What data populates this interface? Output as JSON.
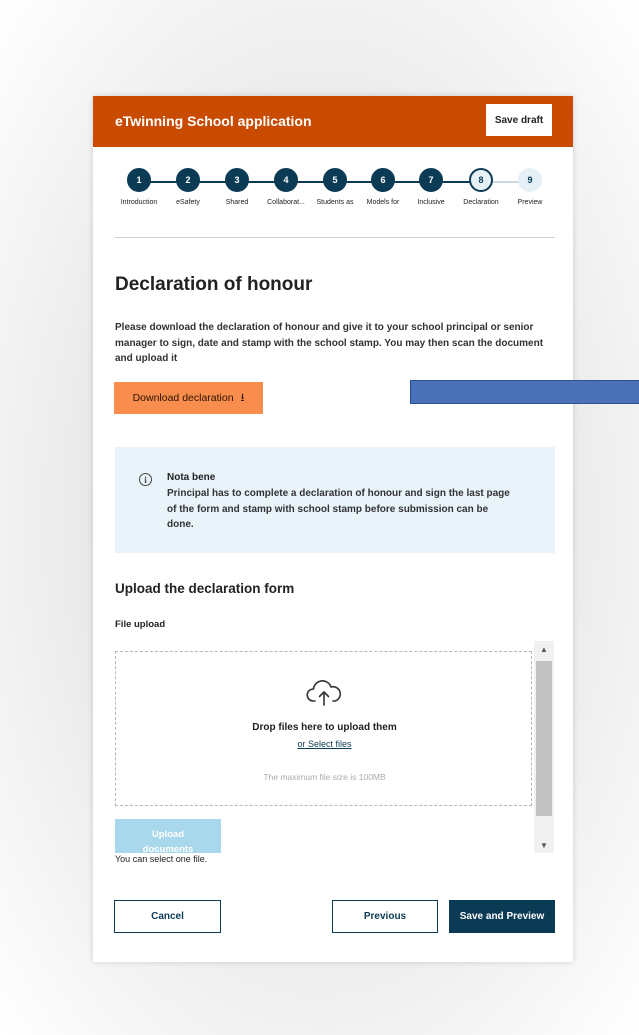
{
  "header": {
    "title": "eTwinning School application",
    "save_draft": "Save draft",
    "color": "#c84b00"
  },
  "stepper": {
    "steps": [
      {
        "number": "1",
        "label": "Introduction",
        "state": "done"
      },
      {
        "number": "2",
        "label": "eSafety",
        "state": "done"
      },
      {
        "number": "3",
        "label": "Shared",
        "state": "done"
      },
      {
        "number": "4",
        "label": "Collaborat...",
        "state": "done"
      },
      {
        "number": "5",
        "label": "Students as",
        "state": "done"
      },
      {
        "number": "6",
        "label": "Models for",
        "state": "done"
      },
      {
        "number": "7",
        "label": "Inclusive",
        "state": "done"
      },
      {
        "number": "8",
        "label": "Declaration",
        "state": "current"
      },
      {
        "number": "9",
        "label": "Preview",
        "state": "future"
      }
    ]
  },
  "main": {
    "title": "Declaration of honour",
    "intro": "Please download the declaration of honour and give it to your school principal or senior manager to sign, date and stamp with the school stamp. You may then scan the document and upload it",
    "download_label": "Download declaration",
    "note": {
      "title": "Nota bene",
      "text": "Principal has to complete a declaration of honour and sign the last page of the form and stamp with school stamp before submission can be done."
    },
    "upload_heading": "Upload the declaration form",
    "file_label": "File upload",
    "dropzone": {
      "drop_text": "Drop files here to upload them",
      "select_link": "or Select files",
      "max_size": "The maximum file size is 100MB"
    },
    "upload_button": "Upload documents",
    "select_hint": "You can select one file."
  },
  "footer": {
    "cancel": "Cancel",
    "previous": "Previous",
    "save_preview": "Save and Preview"
  },
  "colors": {
    "primary": "#0b3a55",
    "accent": "#f98d4e",
    "note_bg": "#e8f4fa"
  }
}
